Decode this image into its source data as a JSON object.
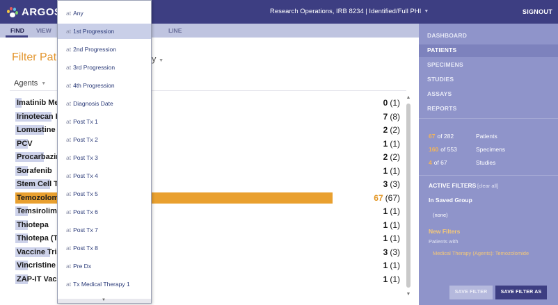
{
  "header": {
    "logo_text": "ARGOS",
    "org_selector": "Research Operations, IRB 8234 | Identified/Full PHI",
    "signout": "SIGNOUT"
  },
  "tabs": [
    {
      "label": "FIND",
      "active": true
    },
    {
      "label": "VIEW",
      "active": false
    },
    {
      "label": "LINE",
      "active": false
    }
  ],
  "main": {
    "title_fragment": "Filter Patie",
    "title_suffix": "y",
    "agents_label": "Agents"
  },
  "agents": [
    {
      "name": "Imatinib Me",
      "count": "0",
      "total": "(1)",
      "mini": 0.1
    },
    {
      "name": "Irinotecan H",
      "count": "7",
      "total": "(8)",
      "mini": 0.58
    },
    {
      "name": "Lomustine",
      "count": "2",
      "total": "(2)",
      "mini": 0.45
    },
    {
      "name": "PCV",
      "count": "1",
      "total": "(1)",
      "mini": 0.2
    },
    {
      "name": "Procarbazin",
      "count": "2",
      "total": "(2)",
      "mini": 0.45
    },
    {
      "name": "Sorafenib",
      "count": "1",
      "total": "(1)",
      "mini": 0.2
    },
    {
      "name": "Stem Cell T",
      "count": "3",
      "total": "(3)",
      "mini": 0.55
    },
    {
      "name": "Temozolom",
      "count": "67",
      "total": "(67)",
      "selected": true
    },
    {
      "name": "Temsirolim",
      "count": "1",
      "total": "(1)",
      "mini": 0.2
    },
    {
      "name": "Thiotepa",
      "count": "1",
      "total": "(1)",
      "mini": 0.2
    },
    {
      "name": "Thiotepa (T",
      "count": "1",
      "total": "(1)",
      "mini": 0.2
    },
    {
      "name": "Vaccine Tria",
      "count": "3",
      "total": "(3)",
      "mini": 0.55
    },
    {
      "name": "Vincristine",
      "count": "1",
      "total": "(1)",
      "mini": 0.2
    },
    {
      "name": "ZAP-IT Vacc",
      "count": "1",
      "total": "(1)",
      "mini": 0.2
    }
  ],
  "dropdown": {
    "prefix": "at",
    "items": [
      {
        "label": "Any"
      },
      {
        "label": "1st Progression",
        "hover": true
      },
      {
        "label": "2nd Progression"
      },
      {
        "label": "3rd Progression"
      },
      {
        "label": "4th Progression"
      },
      {
        "label": "Diagnosis Date"
      },
      {
        "label": "Post Tx 1"
      },
      {
        "label": "Post Tx 2"
      },
      {
        "label": "Post Tx 3"
      },
      {
        "label": "Post Tx 4"
      },
      {
        "label": "Post Tx 5"
      },
      {
        "label": "Post Tx 6"
      },
      {
        "label": "Post Tx 7"
      },
      {
        "label": "Post Tx 8"
      },
      {
        "label": "Pre Dx"
      },
      {
        "label": "Tx Medical Therapy 1"
      }
    ]
  },
  "sidebar": {
    "nav": [
      {
        "label": "DASHBOARD",
        "active": false
      },
      {
        "label": "PATIENTS",
        "active": true
      },
      {
        "label": "SPECIMENS",
        "active": false
      },
      {
        "label": "STUDIES",
        "active": false
      },
      {
        "label": "ASSAYS",
        "active": false
      },
      {
        "label": "REPORTS",
        "active": false
      }
    ],
    "stats": [
      {
        "num": "67",
        "of": "of 282",
        "label": "Patients"
      },
      {
        "num": "160",
        "of": "of 553",
        "label": "Specimens"
      },
      {
        "num": "4",
        "of": "of 67",
        "label": "Studies"
      }
    ],
    "active_filters_title": "ACTIVE FILTERS",
    "clear_all": "[clear all]",
    "saved_group_title": "In Saved Group",
    "saved_group_value": "(none)",
    "new_filters_title": "New Filters",
    "patients_with": "Patients with",
    "filter_entry": "Medical Therapy (Agents): Temozolomide",
    "save_filter": "SAVE FILTER",
    "save_filter_as": "SAVE FILTER AS"
  },
  "colors": {
    "header": "#3d3e82",
    "sidebar": "#8f94ca",
    "accent_orange": "#e9a02f",
    "tab_bar": "#bfc4e0"
  }
}
